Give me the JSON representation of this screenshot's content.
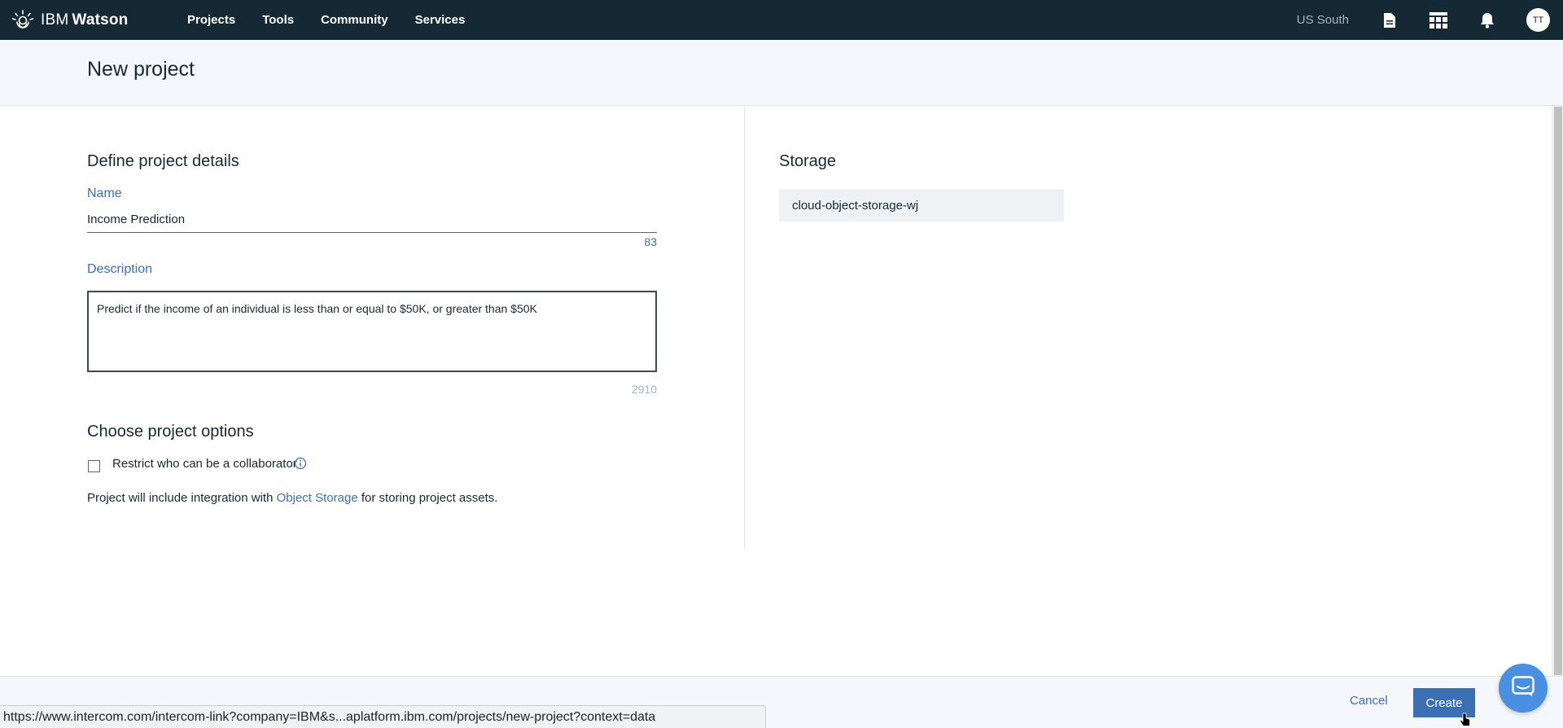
{
  "topbar": {
    "brand_prefix": "IBM",
    "brand_name": "Watson",
    "nav": [
      {
        "label": "Projects"
      },
      {
        "label": "Tools"
      },
      {
        "label": "Community"
      },
      {
        "label": "Services"
      }
    ],
    "region": "US South",
    "avatar_initials": "TT",
    "icons": [
      "watson-logo-icon",
      "document-icon",
      "catalog-grid-icon",
      "bell-icon"
    ]
  },
  "page": {
    "title": "New project"
  },
  "details": {
    "section_title": "Define project details",
    "name_label": "Name",
    "name_value": "Income Prediction",
    "name_counter": "83",
    "description_label": "Description",
    "description_value": "Predict if the income of an individual is less than or equal to $50K, or greater than $50K",
    "description_counter": "2910"
  },
  "options": {
    "section_title": "Choose project options",
    "restrict_label": "Restrict who can be a collaborator",
    "restrict_checked": false,
    "integration_prefix": "Project will include integration with ",
    "integration_link": "Object Storage",
    "integration_suffix": " for storing project assets."
  },
  "storage": {
    "section_title": "Storage",
    "selected": "cloud-object-storage-wj"
  },
  "footer": {
    "cancel_label": "Cancel",
    "create_label": "Create"
  },
  "browser_status": {
    "url": "https://www.intercom.com/intercom-link?company=IBM&s...aplatform.ibm.com/projects/new-project?context=data"
  },
  "colors": {
    "topbar_bg": "#152935",
    "accent_blue": "#3d70b2",
    "header_bg": "#f4f7fb",
    "chat_launcher": "#4a90e2"
  }
}
